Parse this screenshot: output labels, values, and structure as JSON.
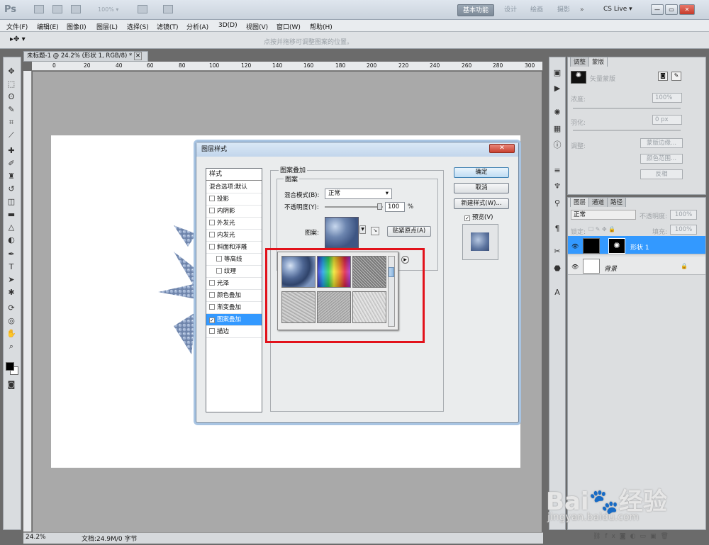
{
  "app": {
    "logo": "Ps",
    "zoom_select": "100% ▾"
  },
  "workspaces": {
    "active": "基本功能",
    "items": [
      "设计",
      "绘画",
      "摄影",
      "»"
    ],
    "cslive": "CS Live ▾"
  },
  "window_buttons": {
    "minimize": "—",
    "restore": "▭",
    "close": "✕"
  },
  "menu": [
    "文件(F)",
    "编辑(E)",
    "图像(I)",
    "图层(L)",
    "选择(S)",
    "滤镜(T)",
    "分析(A)",
    "3D(D)",
    "视图(V)",
    "窗口(W)",
    "帮助(H)"
  ],
  "options_bar": {
    "tool": "▸✥ ▾",
    "hint": "点按并拖移可调整图案的位置。"
  },
  "document": {
    "tab_title": "未标题-1 @ 24.2% (形状 1, RGB/8) *",
    "ruler_labels": [
      "0",
      "20",
      "40",
      "60",
      "80",
      "100",
      "120",
      "140",
      "160",
      "180",
      "200",
      "220",
      "240",
      "260",
      "280",
      "300"
    ],
    "zoom": "24.2%",
    "status": "文档:24.9M/0 字节"
  },
  "adjust_panel": {
    "tabs": [
      "调整",
      "蒙版"
    ],
    "mask_label": "矢量蒙版",
    "density_label": "浓度:",
    "density_value": "100%",
    "feather_label": "羽化:",
    "feather_value": "0 px",
    "refine_label": "调整:",
    "btn_mask_edge": "蒙版边缘...",
    "btn_color_range": "颜色范围...",
    "btn_invert": "反相"
  },
  "layers_panel": {
    "tabs": [
      "图层",
      "通道",
      "路径"
    ],
    "blend_mode": "正常",
    "opacity_label": "不透明度:",
    "opacity_value": "100%",
    "lock_label": "锁定:",
    "fill_label": "填充:",
    "fill_value": "100%",
    "layers": [
      {
        "name": "形状 1",
        "selected": true
      },
      {
        "name": "背景",
        "selected": false
      }
    ]
  },
  "dialog": {
    "title": "图层样式",
    "close": "✕",
    "styles_header": "样式",
    "style_items": [
      {
        "label": "混合选项:默认",
        "checkbox": false
      },
      {
        "label": "投影",
        "checkbox": true,
        "checked": false
      },
      {
        "label": "内阴影",
        "checkbox": true,
        "checked": false
      },
      {
        "label": "外发光",
        "checkbox": true,
        "checked": false
      },
      {
        "label": "内发光",
        "checkbox": true,
        "checked": false
      },
      {
        "label": "斜面和浮雕",
        "checkbox": true,
        "checked": false
      },
      {
        "label": "等高线",
        "checkbox": true,
        "checked": false
      },
      {
        "label": "纹理",
        "checkbox": true,
        "checked": false
      },
      {
        "label": "光泽",
        "checkbox": true,
        "checked": false
      },
      {
        "label": "颜色叠加",
        "checkbox": true,
        "checked": false
      },
      {
        "label": "渐变叠加",
        "checkbox": true,
        "checked": false
      },
      {
        "label": "图案叠加",
        "checkbox": true,
        "checked": true
      },
      {
        "label": "描边",
        "checkbox": true,
        "checked": false
      }
    ],
    "group_title": "图案叠加",
    "subgroup_title": "图案",
    "blend_label": "混合模式(B):",
    "blend_value": "正常",
    "opacity_label": "不透明度(Y):",
    "opacity_value": "100",
    "opacity_unit": "%",
    "opacity_level": 1.0,
    "pattern_label": "图案:",
    "snap_origin": "贴紧原点(A)",
    "btn_ok": "确定",
    "btn_cancel": "取消",
    "btn_new_style": "新建样式(W)...",
    "preview_label": "预览(V)",
    "preview_checked": true
  },
  "watermark": {
    "logo": "Bai経验",
    "url": "jingyan.baidu.com"
  },
  "colors": {
    "accent": "#3399ff",
    "highlight_box": "#e2121b",
    "canvas_bg": "#a9a9a9"
  }
}
